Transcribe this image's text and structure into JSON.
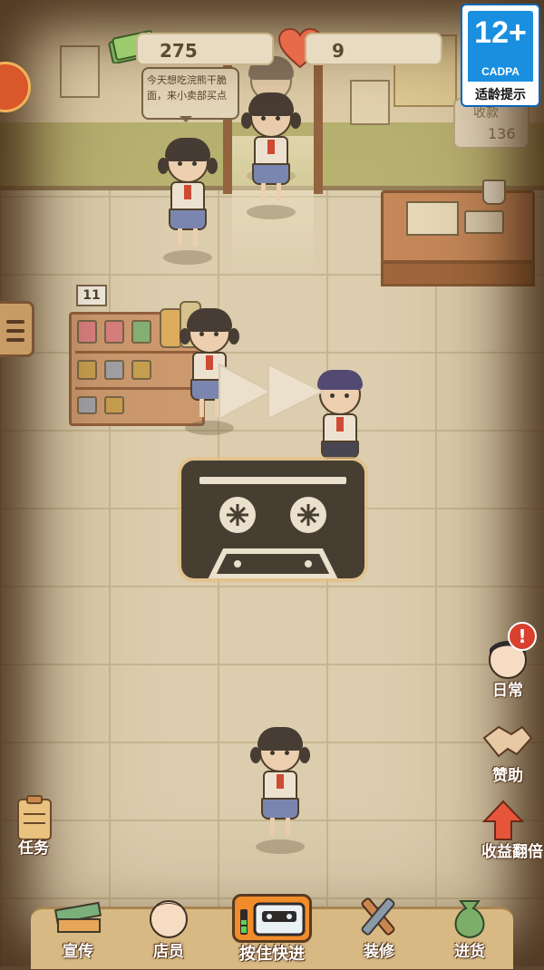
{
  "hud": {
    "money": "275",
    "hearts": "9"
  },
  "age_rating": {
    "number": "12+",
    "org": "CADPA",
    "tip": "适龄提示"
  },
  "speech_bubble": "今天想吃浣熊干脆面，来小卖部买点",
  "income": {
    "label": "收款",
    "value": "136"
  },
  "shelf_tag": "11",
  "side_buttons": {
    "daily": "日常",
    "sponsor": "赞助",
    "boost": "收益翻倍",
    "task": "任务"
  },
  "bottom_nav": {
    "promo": "宣传",
    "staff": "店员",
    "fast_forward": "按住快进",
    "decor": "装修",
    "stock": "进货"
  },
  "colors": {
    "accent_orange": "#f08d2a",
    "alert_red": "#d9402e",
    "cadpa_blue": "#1a8fe0"
  }
}
